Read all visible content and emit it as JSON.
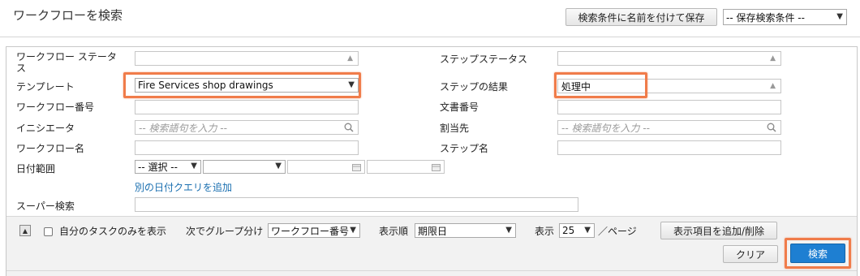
{
  "header": {
    "title": "ワークフローを検索",
    "save_search_button": "検索条件に名前を付けて保存",
    "saved_search_select": "-- 保存検索条件 --"
  },
  "form": {
    "workflow_status_label_line1": "ワークフロー ステータ",
    "workflow_status_label_line2": "ス",
    "step_status_label": "ステップステータス",
    "template_label": "テンプレート",
    "template_value": "Fire Services shop drawings",
    "step_result_label": "ステップの結果",
    "step_result_value": "処理中",
    "workflow_number_label": "ワークフロー番号",
    "document_number_label": "文書番号",
    "initiator_label": "イニシエータ",
    "initiator_placeholder": "-- 検索語句を入力 --",
    "assignee_label": "割当先",
    "assignee_placeholder": "-- 検索語句を入力 --",
    "workflow_name_label": "ワークフロー名",
    "step_name_label": "ステップ名",
    "date_range_label": "日付範囲",
    "date_range_select": "-- 選択 --",
    "add_date_query_link": "別の日付クエリを追加",
    "super_search_label": "スーパー検索"
  },
  "options": {
    "my_tasks_only_label": "自分のタスクのみを表示",
    "group_by_label": "次でグループ分け",
    "group_by_value": "ワークフロー番号",
    "sort_by_label": "表示順",
    "sort_by_value": "期限日",
    "show_label": "表示",
    "page_size_value": "25",
    "per_page_label": "／ページ",
    "add_remove_columns_button": "表示項目を追加/削除"
  },
  "actions": {
    "clear_button": "クリア",
    "search_button": "検索"
  },
  "colors": {
    "highlight": "#f07c4a",
    "primary": "#1e7fd2",
    "link": "#1a6fb0"
  }
}
